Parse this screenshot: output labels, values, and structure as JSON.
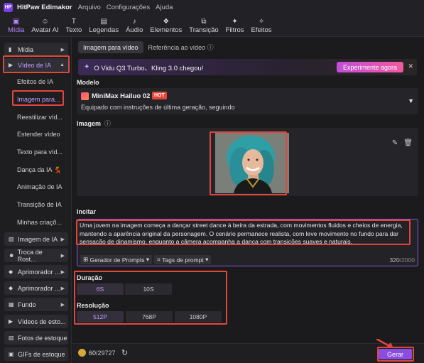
{
  "app": {
    "title": "HitPaw Edimakor",
    "logo_text": "HP"
  },
  "menu": [
    "Arquivo",
    "Configurações",
    "Ajuda"
  ],
  "toolbar": [
    {
      "label": "Mídia",
      "icon": "media-icon",
      "active": true
    },
    {
      "label": "Avatar AI",
      "icon": "avatar-icon"
    },
    {
      "label": "Texto",
      "icon": "text-icon"
    },
    {
      "label": "Legendas",
      "icon": "captions-icon"
    },
    {
      "label": "Áudio",
      "icon": "music-icon"
    },
    {
      "label": "Elementos",
      "icon": "elements-icon"
    },
    {
      "label": "Transição",
      "icon": "transition-icon"
    },
    {
      "label": "Filtros",
      "icon": "filters-icon"
    },
    {
      "label": "Efeitos",
      "icon": "effects-icon"
    }
  ],
  "sidebar": {
    "items": [
      {
        "label": "Mídia"
      },
      {
        "label": "Vídeo de IA"
      },
      {
        "label": "Imagem de IA"
      },
      {
        "label": "Troca de Rost..."
      },
      {
        "label": "Aprimorador ..."
      },
      {
        "label": "Aprimorador ..."
      },
      {
        "label": "Fundo"
      },
      {
        "label": "Vídeos de esto..."
      },
      {
        "label": "Fotos de estoque"
      },
      {
        "label": "GIFs de estoque"
      }
    ],
    "sub_items": [
      "Efeitos de IA",
      "Imagem para...",
      "Reestilizar víd...",
      "Estender vídeo",
      "Texto para víd...",
      "Dança da IA 💃",
      "Animação de IA",
      "Transição de IA",
      "Minhas criaçõ..."
    ]
  },
  "tabs": [
    "Imagem para vídeo",
    "Referência ao vídeo"
  ],
  "banner": {
    "text": "O Vidu Q3 Turbo、Kling 3.0 chegou!",
    "cta": "Experimente agora",
    "close": "✕"
  },
  "model": {
    "section": "Modelo",
    "name": "MiniMax Hailuo 02",
    "badge": "HOT",
    "description": "Equipado com instruções de última geração, seguindo"
  },
  "image_section": {
    "label": "Imagem"
  },
  "prompt": {
    "label": "Incitar",
    "text": "Uma jovem na imagem começa a dançar street dance à beira da estrada, com movimentos fluidos e cheios de energia, mantendo a aparência original da personagem. O cenário permanece realista, com leve movimento no fundo para dar sensação de dinamismo, enquanto a câmera acompanha a dança com transições suaves e naturais.",
    "generator_btn": "Gerador de Prompts",
    "tags_btn": "Tags de prompt",
    "count": "320",
    "max": "/2000"
  },
  "duration": {
    "label": "Duração",
    "options": [
      "6S",
      "10S"
    ],
    "selected": "6S"
  },
  "resolution": {
    "label": "Resolução",
    "options": [
      "512P",
      "768P",
      "1080P"
    ],
    "selected": "512P"
  },
  "footer": {
    "credits_used": "60",
    "credits_total": "/29727",
    "generate": "Gerar"
  },
  "colors": {
    "accent": "#8b4ce0",
    "highlight": "#e0473a",
    "background": "#1b1b1e"
  }
}
